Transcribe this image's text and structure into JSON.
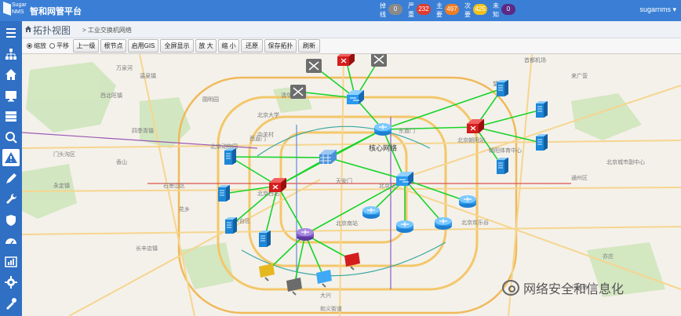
{
  "header": {
    "logo_line1": "Sugar",
    "logo_line2": "NMS",
    "app_title": "智和网管平台",
    "user": "sugarnms ▾",
    "alarms": [
      {
        "label": "掉线",
        "count": "0",
        "color": "#8a8a8a"
      },
      {
        "label": "严重",
        "count": "232",
        "color": "#e23a2e"
      },
      {
        "label": "主要",
        "count": "497",
        "color": "#f07c22"
      },
      {
        "label": "次要",
        "count": "425",
        "color": "#f2c21b"
      },
      {
        "label": "未知",
        "count": "0",
        "color": "#5b2a86"
      }
    ]
  },
  "sidebar": {
    "items": [
      {
        "icon": "menu-icon"
      },
      {
        "icon": "topology-icon"
      },
      {
        "icon": "home-icon"
      },
      {
        "icon": "monitor-icon"
      },
      {
        "icon": "server-icon"
      },
      {
        "icon": "search-icon"
      },
      {
        "icon": "warning-icon"
      },
      {
        "icon": "pencil-icon"
      },
      {
        "icon": "wrench-icon"
      },
      {
        "icon": "shield-icon"
      },
      {
        "icon": "dashboard-icon"
      },
      {
        "icon": "report-icon"
      },
      {
        "icon": "gear-icon"
      },
      {
        "icon": "tool-icon"
      }
    ]
  },
  "breadcrumb": {
    "title": "拓扑视图",
    "sub": "> 工业交换机网络"
  },
  "toolbar": {
    "radio_zoom": "缩放",
    "radio_pan": "平移",
    "buttons": [
      "上一级",
      "根节点",
      "启用GIS",
      "全屏显示",
      "放 大",
      "缩 小",
      "还原",
      "保存拓扑",
      "刷新"
    ]
  },
  "map": {
    "core_label": "核心网络",
    "place_labels": [
      "温泉镇",
      "圆明园",
      "北京大学",
      "清华大学",
      "中关村",
      "北京动物园",
      "西直门",
      "北京西站",
      "天安门",
      "北京站",
      "东直门",
      "北京朝阳站",
      "朝阳体育中心",
      "北京欢乐谷",
      "北京南站",
      "首都机场",
      "来广营",
      "望京",
      "四季青镇",
      "西北旺镇",
      "石景山区",
      "门头沟区",
      "永定镇",
      "长辛店镇",
      "丰台区",
      "大兴",
      "通州区",
      "北京城市副中心",
      "万泉河",
      "亦庄",
      "花乡",
      "和义街道",
      "香山",
      "马驹桥"
    ],
    "watermark": "网络安全和信息化"
  },
  "colors": {
    "topbar": "#3a7fd5",
    "sidebar": "#2f6fc4",
    "link": "#18d42a"
  }
}
